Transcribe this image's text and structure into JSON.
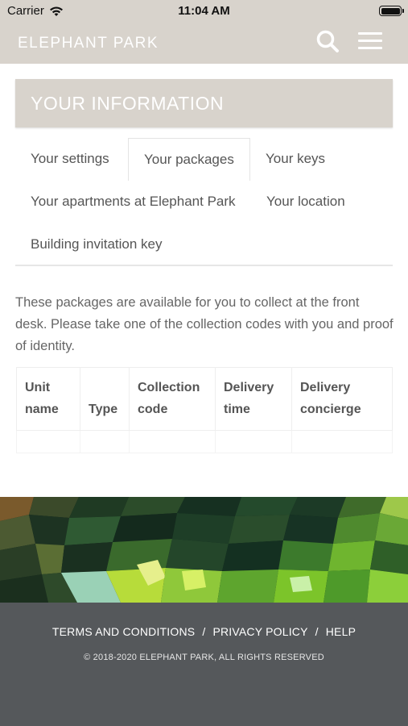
{
  "status_bar": {
    "carrier": "Carrier",
    "time": "11:04 AM"
  },
  "header": {
    "brand": "ELEPHANT PARK"
  },
  "section": {
    "title": "YOUR INFORMATION"
  },
  "tabs": [
    {
      "label": "Your settings",
      "active": false
    },
    {
      "label": "Your packages",
      "active": true
    },
    {
      "label": "Your keys",
      "active": false
    },
    {
      "label": "Your apartments at Elephant Park",
      "active": false
    },
    {
      "label": "Your location",
      "active": false
    },
    {
      "label": "Building invitation key",
      "active": false
    }
  ],
  "packages": {
    "intro": "These packages are available for you to collect at the front desk. Please take one of the collection codes with you and proof of identity.",
    "columns": [
      "Unit name",
      "Type",
      "Collection code",
      "Delivery time",
      "Delivery concierge"
    ],
    "rows": []
  },
  "footer": {
    "links": [
      "TERMS AND CONDITIONS",
      "PRIVACY POLICY",
      "HELP"
    ],
    "separator": "/",
    "copyright": "© 2018-2020 ELEPHANT PARK, ALL RIGHTS RESERVED"
  },
  "colors": {
    "header_bg": "#d8d3cc",
    "footer_bg": "#55585b",
    "accent_green": "#7cc42a"
  }
}
